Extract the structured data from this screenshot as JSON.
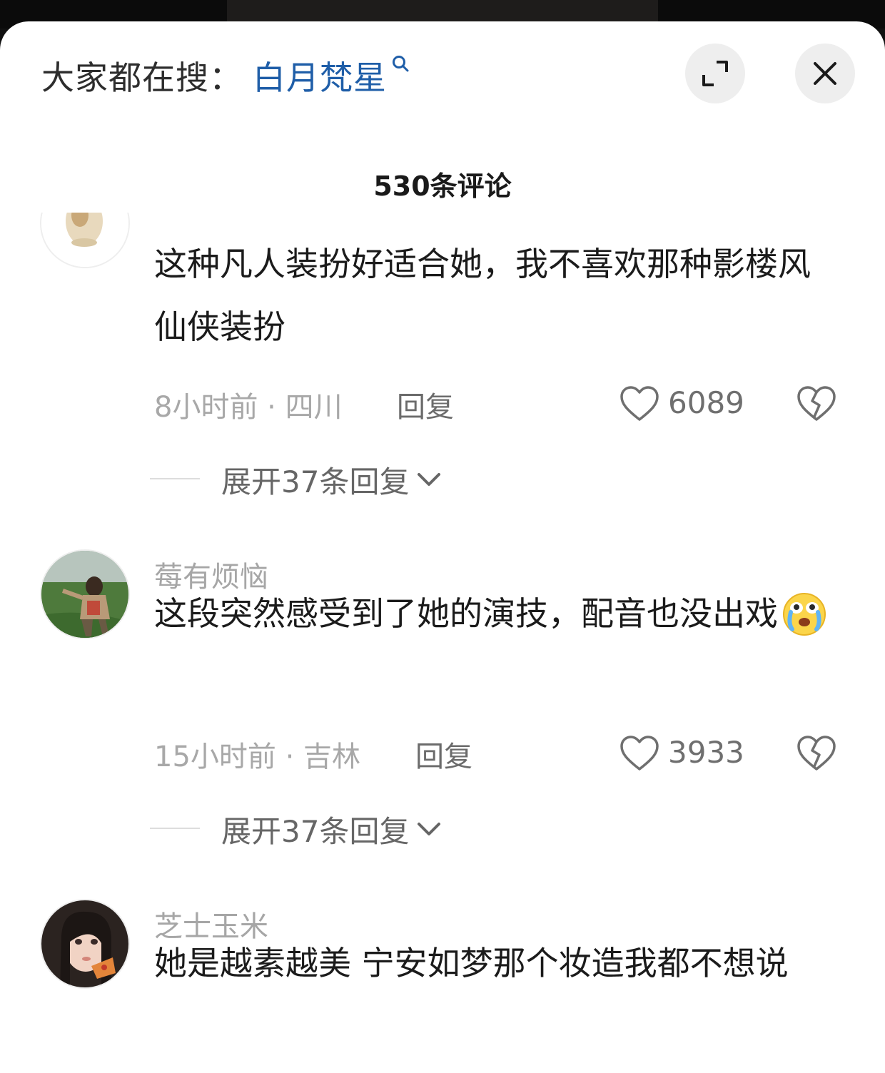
{
  "search": {
    "prefix": "大家都在搜：",
    "term": "白月梵星"
  },
  "header": {
    "comment_count": "530条评论"
  },
  "icons": {
    "expand": "expand-icon",
    "close": "close-icon",
    "like": "heart-icon",
    "dislike": "broken-heart-icon",
    "search": "search-icon"
  },
  "colors": {
    "accent": "#1f5ea8"
  },
  "comments": [
    {
      "username": "",
      "text": "这种凡人装扮好适合她，我不喜欢那种影楼风仙侠装扮",
      "meta": "8小时前 · 四川",
      "reply": "回复",
      "likes": "6089",
      "expand": "展开37条回复"
    },
    {
      "username": "莓有烦恼",
      "text": "这段突然感受到了她的演技，配音也没出戏",
      "emoji": "crying-face",
      "meta": "15小时前 · 吉林",
      "reply": "回复",
      "likes": "3933",
      "expand": "展开37条回复"
    },
    {
      "username": "芝士玉米",
      "text": "她是越素越美 宁安如梦那个妆造我都不想说"
    }
  ]
}
